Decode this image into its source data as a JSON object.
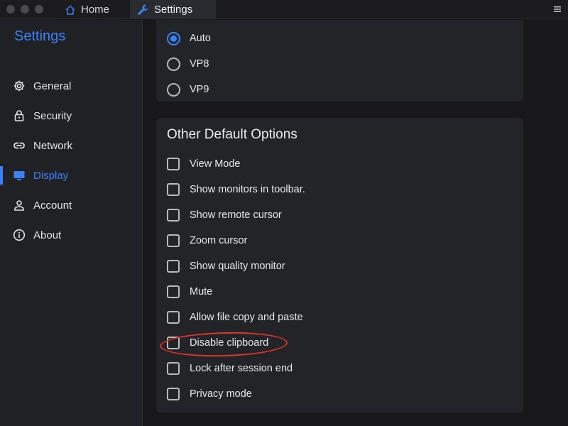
{
  "tabs": [
    {
      "label": "Home",
      "icon": "home-icon"
    },
    {
      "label": "Settings",
      "icon": "wrench-icon"
    }
  ],
  "sidebar": {
    "title": "Settings",
    "items": [
      {
        "label": "General",
        "icon": "gear-icon"
      },
      {
        "label": "Security",
        "icon": "lock-icon"
      },
      {
        "label": "Network",
        "icon": "link-icon"
      },
      {
        "label": "Display",
        "icon": "monitor-icon",
        "active": true
      },
      {
        "label": "Account",
        "icon": "person-icon"
      },
      {
        "label": "About",
        "icon": "info-icon"
      }
    ]
  },
  "codec": {
    "options": [
      {
        "label": "Auto",
        "selected": true
      },
      {
        "label": "VP8",
        "selected": false
      },
      {
        "label": "VP9",
        "selected": false
      }
    ]
  },
  "other_options": {
    "title": "Other Default Options",
    "items": [
      {
        "label": "View Mode",
        "checked": false
      },
      {
        "label": "Show monitors in toolbar.",
        "checked": false
      },
      {
        "label": "Show remote cursor",
        "checked": false
      },
      {
        "label": "Zoom cursor",
        "checked": false
      },
      {
        "label": "Show quality monitor",
        "checked": false
      },
      {
        "label": "Mute",
        "checked": false
      },
      {
        "label": "Allow file copy and paste",
        "checked": false
      },
      {
        "label": "Disable clipboard",
        "checked": false
      },
      {
        "label": "Lock after session end",
        "checked": false
      },
      {
        "label": "Privacy mode",
        "checked": false
      }
    ]
  },
  "colors": {
    "accent": "#3b82f6",
    "annotation": "#d8362a"
  }
}
